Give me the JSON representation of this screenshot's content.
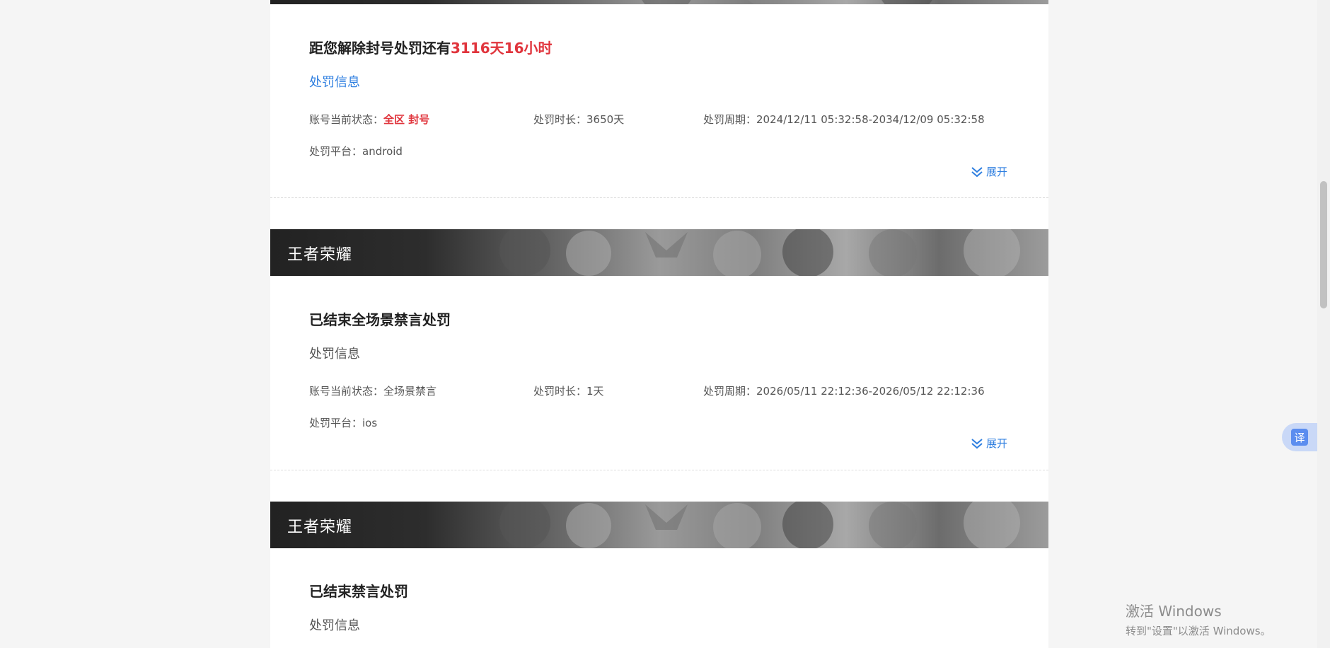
{
  "cards": [
    {
      "game_name": "",
      "title_prefix": "距您解除封号处罚还有",
      "title_highlight": "3116天16小时",
      "section_label": "处罚信息",
      "status_label": "账号当前状态：",
      "status_value": "全区 封号",
      "duration_label": "处罚时长：",
      "duration_value": "3650天",
      "period_label": "处罚周期：",
      "period_value": "2024/12/11 05:32:58-2034/12/09 05:32:58",
      "platform_label": "处罚平台：",
      "platform_value": "android",
      "expand_label": "展开"
    },
    {
      "game_name": "王者荣耀",
      "title_prefix": "已结束全场景禁言处罚",
      "title_highlight": "",
      "section_label": "处罚信息",
      "status_label": "账号当前状态：",
      "status_value": "全场景禁言",
      "duration_label": "处罚时长：",
      "duration_value": "1天",
      "period_label": "处罚周期：",
      "period_value": "2026/05/11 22:12:36-2026/05/12 22:12:36",
      "platform_label": "处罚平台：",
      "platform_value": "ios",
      "expand_label": "展开"
    },
    {
      "game_name": "王者荣耀",
      "title_prefix": "已结束禁言处罚",
      "title_highlight": "",
      "section_label": "处罚信息"
    }
  ],
  "translate_button": {
    "label": "译"
  },
  "watermark": {
    "line1": "激活 Windows",
    "line2": "转到\"设置\"以激活 Windows。"
  },
  "colors": {
    "accent_blue": "#2f7fe0",
    "alert_red": "#e0343c"
  },
  "icons": {
    "expand": "double-chevron-down-icon",
    "translate": "translate-icon"
  }
}
